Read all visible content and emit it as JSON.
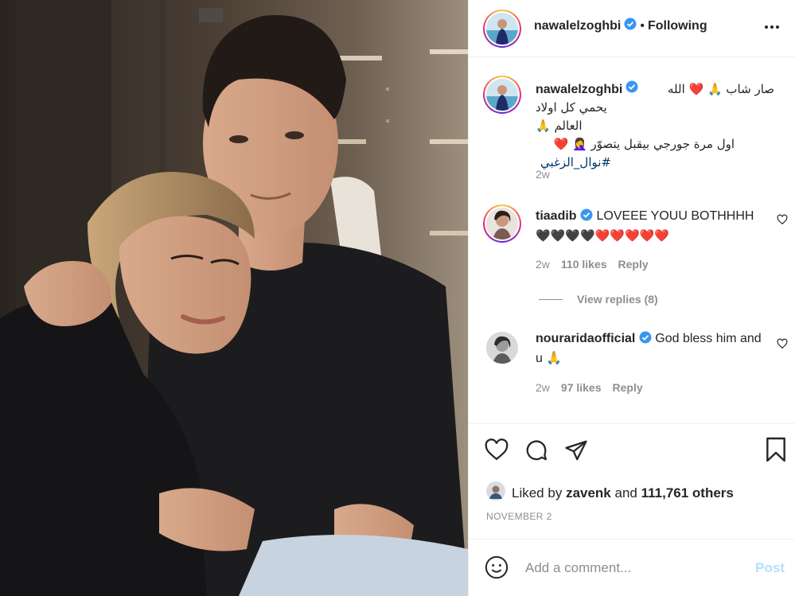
{
  "post": {
    "author": "nawalelzoghbi",
    "follow_status": "Following",
    "separator": "•"
  },
  "caption": {
    "username": "nawalelzoghbi",
    "line1": "صار شاب 🙏 ❤️ الله",
    "line2": "يحمي كل اولاد العالم 🙏",
    "line3": "اول مرة جورجي بيقبل يتصوّر 🤦‍♀️ ❤️",
    "hashtag": "#نوال_الزغبي",
    "time": "2w"
  },
  "comments": [
    {
      "username": "tiaadib",
      "text": "LOVEEE YOUU BOTHHHH",
      "hearts": "🖤🖤🖤🖤❤️❤️❤️❤️❤️",
      "time": "2w",
      "likes": "110 likes",
      "reply": "Reply",
      "view_replies": "View replies (8)"
    },
    {
      "username": "nouraridaofficial",
      "text": "God bless him and u 🙏",
      "time": "2w",
      "likes": "97 likes",
      "reply": "Reply"
    }
  ],
  "engagement": {
    "liked_by_prefix": "Liked by",
    "liked_by_user": "zavenk",
    "liked_by_and": "and",
    "others": "111,761 others",
    "date": "NOVEMBER 2"
  },
  "composer": {
    "placeholder": "Add a comment...",
    "post_label": "Post"
  },
  "icons": {
    "verified": "verified-badge-icon",
    "more": "more-options-icon",
    "like": "heart-icon",
    "comment": "comment-bubble-icon",
    "share": "paper-plane-icon",
    "save": "bookmark-icon",
    "emoji": "smiley-icon"
  },
  "colors": {
    "verified_blue": "#3897f0",
    "muted": "#8e8e8e",
    "post_disabled": "#b2dffc",
    "hashtag": "#00376b"
  }
}
